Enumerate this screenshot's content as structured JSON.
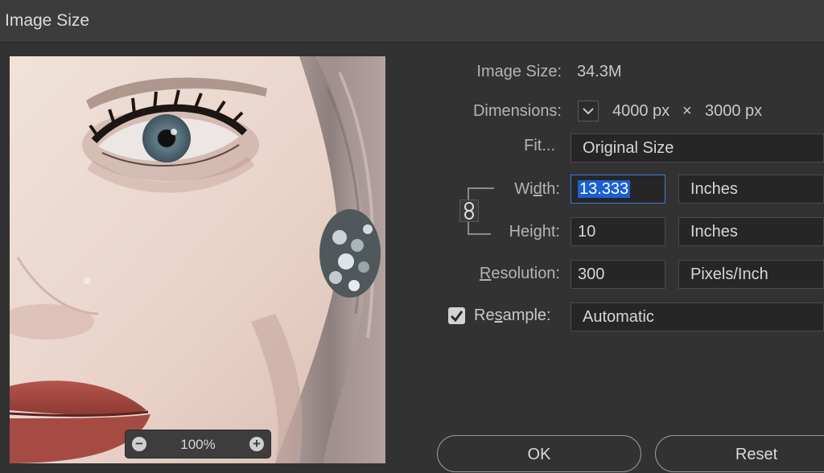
{
  "window": {
    "title": "Image Size"
  },
  "preview": {
    "zoom": "100%"
  },
  "info": {
    "image_size_label": "Image Size:",
    "image_size_value": "34.3M",
    "dimensions_label": "Dimensions:",
    "dim_width": "4000 px",
    "dim_times": "×",
    "dim_height": "3000 px"
  },
  "fit": {
    "label": "Fit...",
    "value": "Original Size"
  },
  "width": {
    "label_pre": "Wi",
    "label_u": "d",
    "label_post": "th:",
    "value": "13.333",
    "unit": "Inches"
  },
  "height": {
    "label_pre": "Hei",
    "label_u": "g",
    "label_post": "ht:",
    "value": "10",
    "unit": "Inches"
  },
  "resolution": {
    "label_u": "R",
    "label_post": "esolution:",
    "value": "300",
    "unit": "Pixels/Inch"
  },
  "resample": {
    "label_pre": "Re",
    "label_u": "s",
    "label_post": "ample:",
    "checked": true,
    "value": "Automatic"
  },
  "buttons": {
    "ok": "OK",
    "reset": "Reset"
  }
}
